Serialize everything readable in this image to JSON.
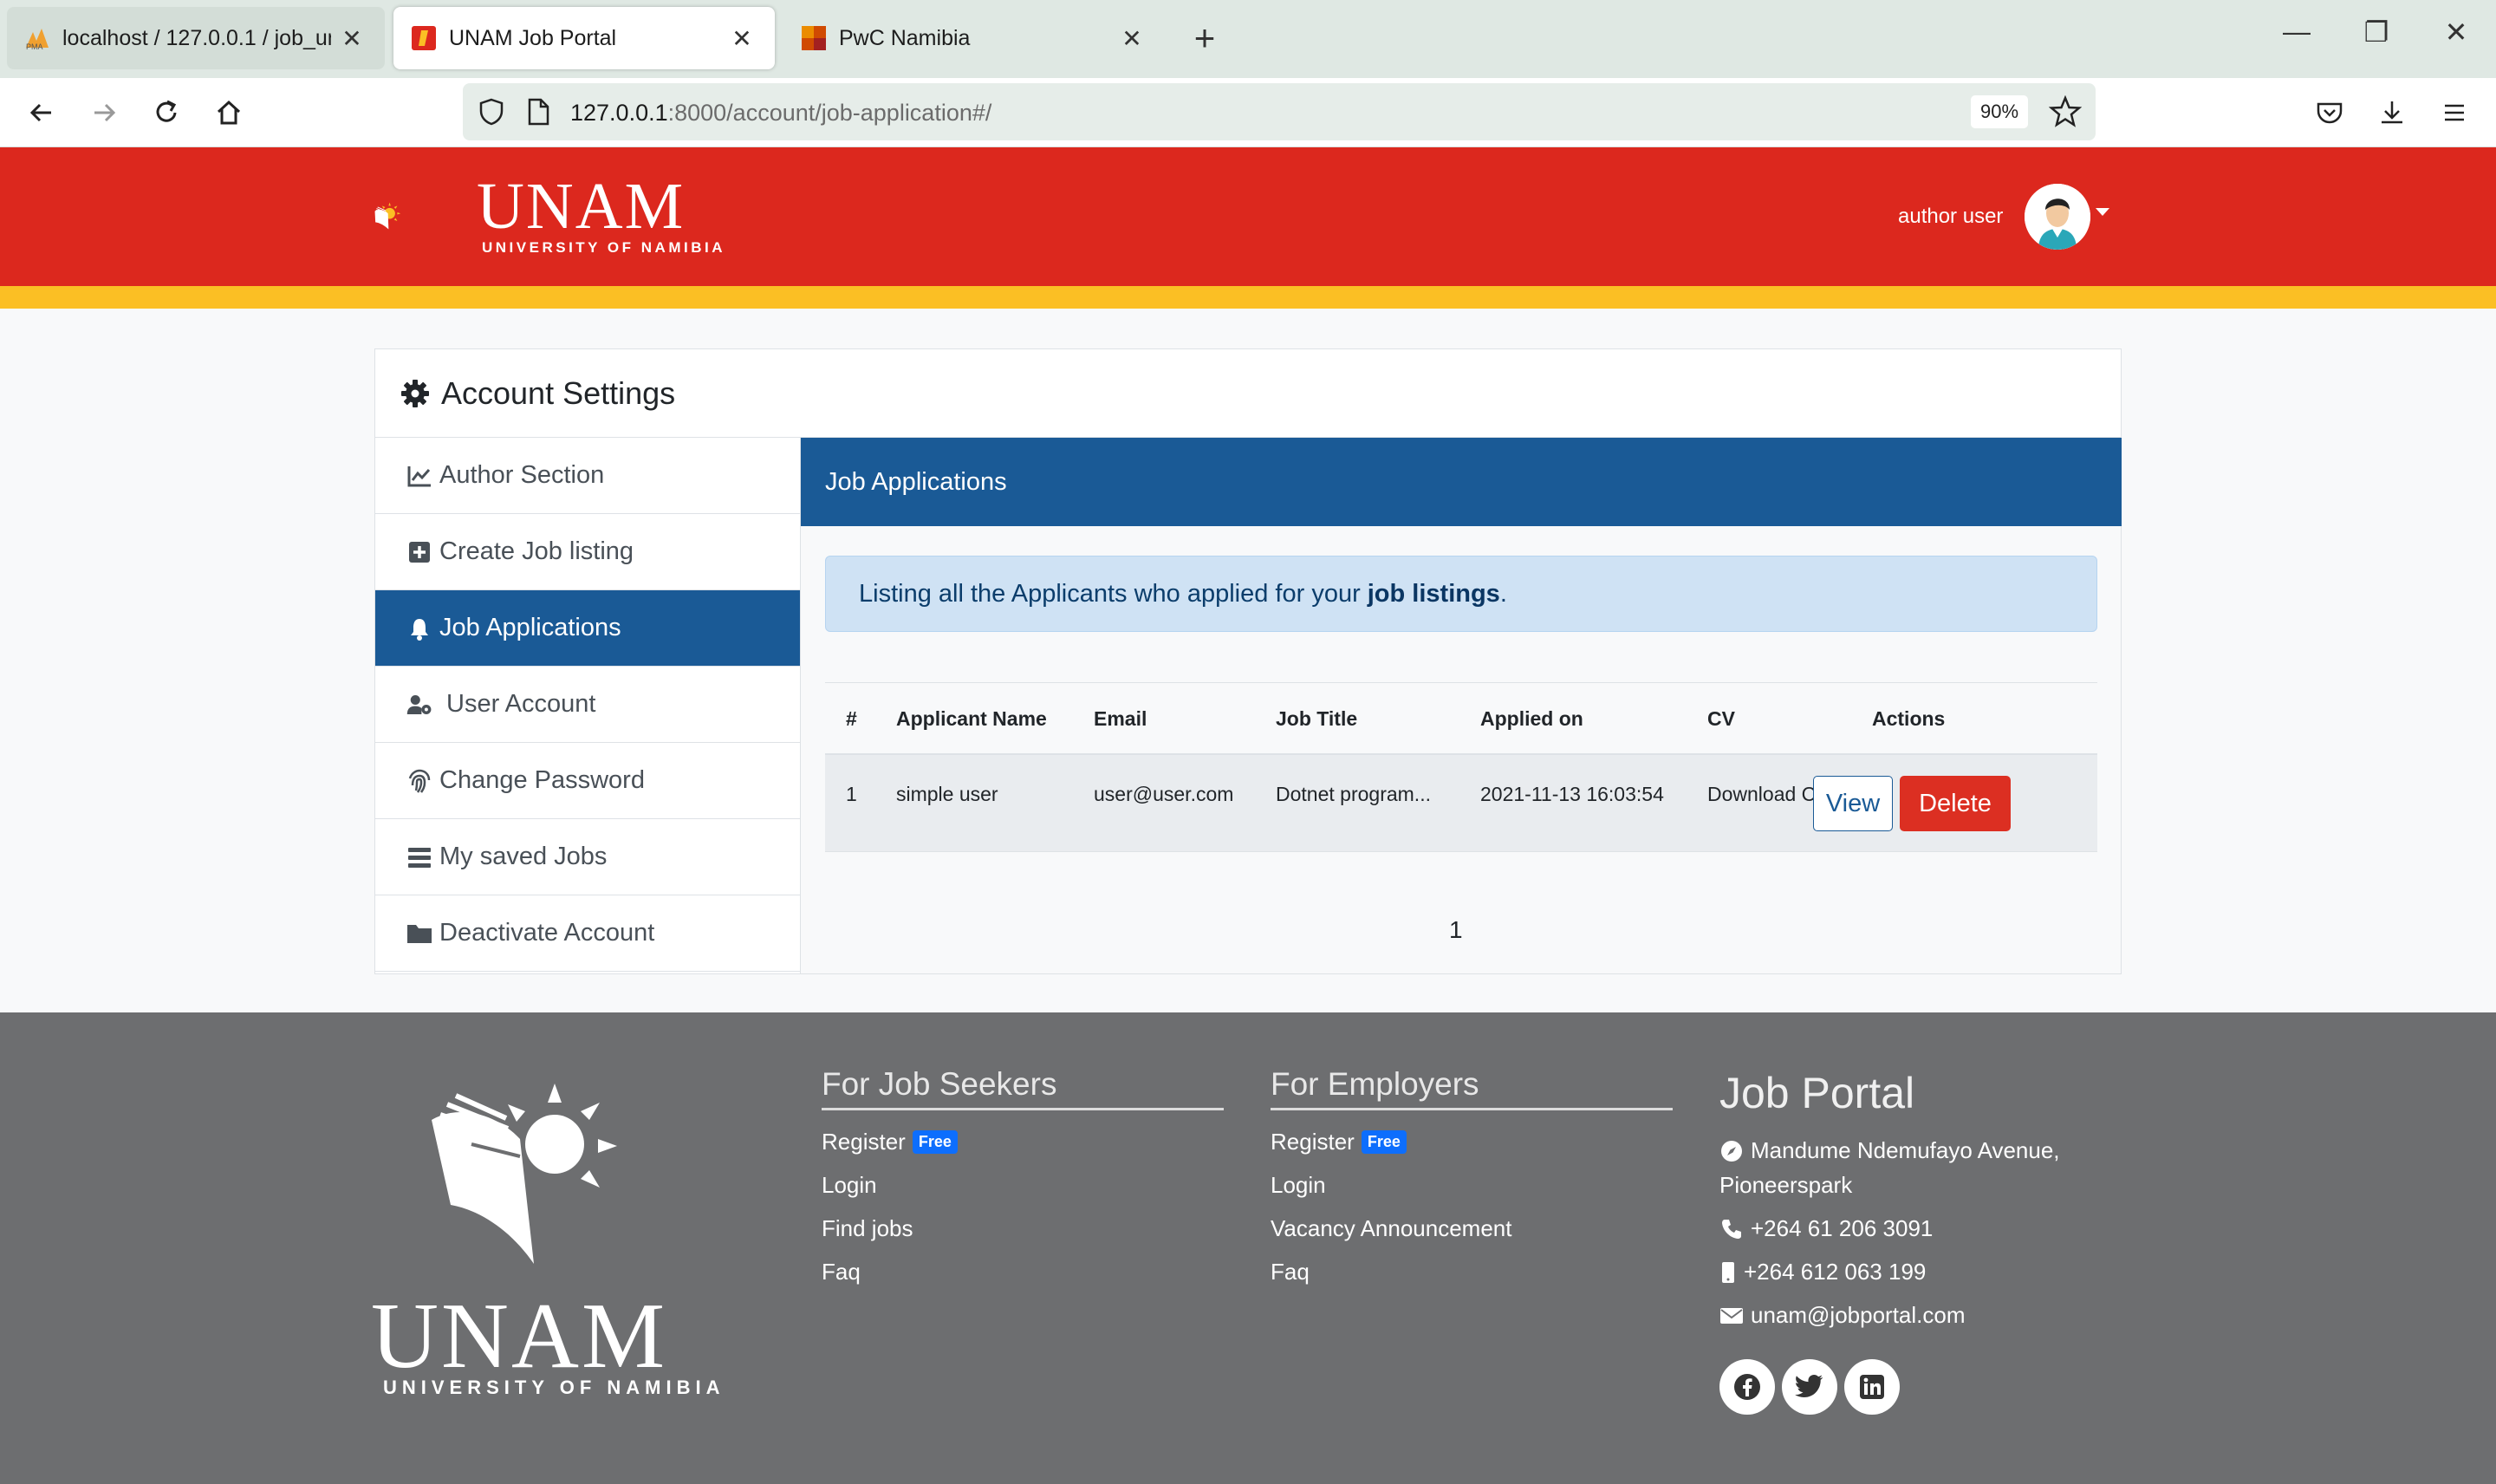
{
  "browser": {
    "tabs": [
      {
        "title": "localhost / 127.0.0.1 / job_unam",
        "active": false
      },
      {
        "title": "UNAM Job Portal",
        "active": true
      },
      {
        "title": "PwC Namibia",
        "active": false
      }
    ],
    "url_host": "127.0.0.1",
    "url_path": ":8000/account/job-application#/",
    "zoom": "90%"
  },
  "header": {
    "logo_text": "UNAM",
    "logo_subtitle": "UNIVERSITY OF NAMIBIA",
    "user_name": "author user"
  },
  "account": {
    "title": "Account Settings",
    "sidebar": [
      {
        "label": "Author Section",
        "icon": "chart-line-icon",
        "active": false
      },
      {
        "label": "Create Job listing",
        "icon": "plus-square-icon",
        "active": false
      },
      {
        "label": "Job Applications",
        "icon": "bell-icon",
        "active": true
      },
      {
        "label": "User Account",
        "icon": "user-cog-icon",
        "active": false
      },
      {
        "label": "Change Password",
        "icon": "fingerprint-icon",
        "active": false
      },
      {
        "label": "My saved Jobs",
        "icon": "list-icon",
        "active": false
      },
      {
        "label": "Deactivate Account",
        "icon": "folder-icon",
        "active": false
      }
    ]
  },
  "main": {
    "heading": "Job Applications",
    "alert_text": "Listing all the Applicants who applied for your",
    "alert_bold": "job listings",
    "alert_end": ".",
    "table": {
      "headers": [
        "#",
        "Applicant Name",
        "Email",
        "Job Title",
        "Applied on",
        "CV",
        "Actions"
      ],
      "rows": [
        {
          "num": "1",
          "name": "simple user",
          "email": "user@user.com",
          "job": "Dotnet program...",
          "applied": "2021-11-13 16:03:54",
          "cv": "Download CV"
        }
      ],
      "view_label": "View",
      "delete_label": "Delete"
    },
    "page": "1"
  },
  "footer": {
    "logo_text": "UNAM",
    "logo_subtitle": "UNIVERSITY OF NAMIBIA",
    "job_seekers": {
      "title": "For Job Seekers",
      "register": "Register",
      "free": "Free",
      "links": [
        "Login",
        "Find jobs",
        "Faq"
      ]
    },
    "employers": {
      "title": "For Employers",
      "register": "Register",
      "free": "Free",
      "links": [
        "Login",
        "Vacancy Announcement",
        "Faq"
      ]
    },
    "job_portal": {
      "title": "Job Portal",
      "address_line1": "Mandume Ndemufayo Avenue,",
      "address_line2": "Pioneerspark",
      "phone": "+264 61 206 3091",
      "mobile": "+264 612 063 199",
      "email": "unam@jobportal.com"
    }
  },
  "colors": {
    "brand_red": "#dc281e",
    "brand_yellow": "#fbbf24",
    "primary_blue": "#1a5a96",
    "danger": "#dc2f22",
    "footer_gray": "#6d6e70"
  }
}
